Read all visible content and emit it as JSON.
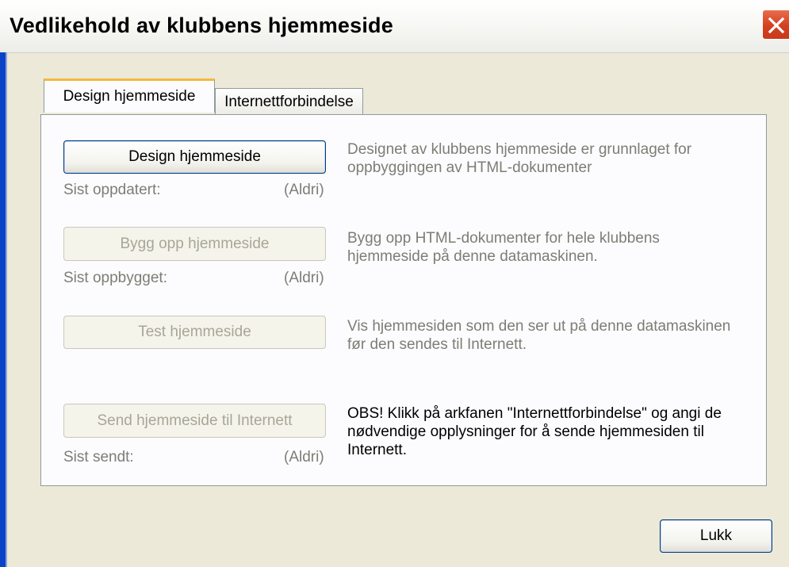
{
  "window": {
    "title": "Vedlikehold av klubbens hjemmeside",
    "close_label": "✕"
  },
  "tabs": [
    {
      "label": "Design hjemmeside",
      "active": true
    },
    {
      "label": "Internettforbindelse",
      "active": false
    }
  ],
  "sections": [
    {
      "button_label": "Design hjemmeside",
      "enabled": true,
      "status_label": "Sist oppdatert:",
      "status_value": "(Aldri)",
      "description": "Designet av klubbens hjemmeside er grunnlaget for oppbyggingen av HTML-dokumenter"
    },
    {
      "button_label": "Bygg opp hjemmeside",
      "enabled": false,
      "status_label": "Sist oppbygget:",
      "status_value": "(Aldri)",
      "description": "Bygg opp HTML-dokumenter for hele klubbens hjemmeside på denne datamaskinen."
    },
    {
      "button_label": "Test hjemmeside",
      "enabled": false,
      "description": "Vis hjemmesiden som den ser ut på denne datamaskinen før den sendes til Internett."
    },
    {
      "button_label": "Send hjemmeside til Internett",
      "enabled": false,
      "status_label": "Sist sendt:",
      "status_value": "(Aldri)",
      "description": "OBS! Klikk på arkfanen \"Internettforbindelse\" og angi de nødvendige opplysninger for å sende hjemmesiden til Internett."
    }
  ],
  "footer": {
    "close_button_label": "Lukk"
  },
  "colors": {
    "dialog_bg": "#ece9d8",
    "tab_accent": "#f5b93c",
    "close_red": "#d4401f",
    "disabled_text": "#a7a698"
  }
}
